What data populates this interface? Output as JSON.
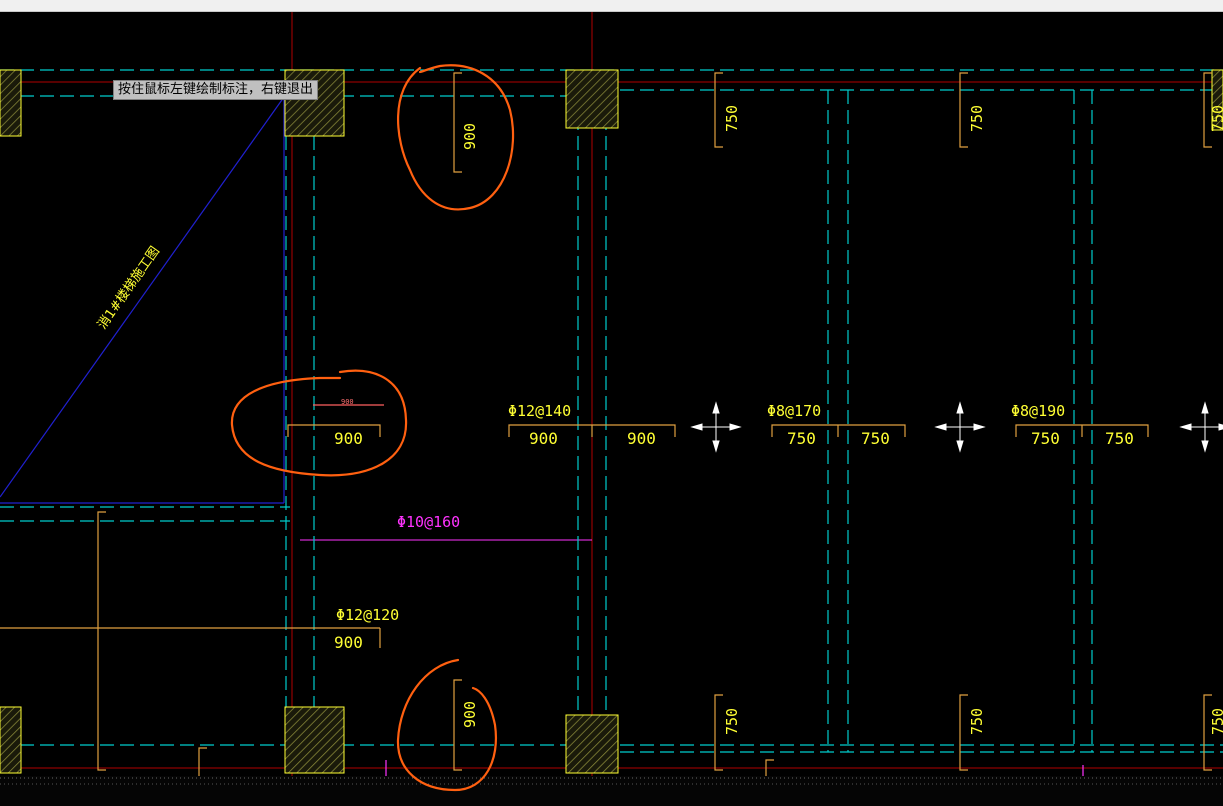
{
  "status": {
    "tooltip": "按住鼠标左键绘制标注，右键退出"
  },
  "colors": {
    "background": "#000000",
    "axis_line": "#b00000",
    "beam_dash": "#00ffff",
    "dimension": "#ffff33",
    "dimension_bracket": "#e0a040",
    "rebar_text": "#ff33ff",
    "column_hatch": "#8a8a3a",
    "diagonal": "#2020d0",
    "markup": "#ff6010"
  },
  "drawing": {
    "dims": {
      "top_900": "900",
      "mid_900": "900",
      "mid_900_small": "900",
      "bot_900": "900",
      "left_900": "900",
      "bottom_left_900": "900",
      "top_750_a": "750",
      "top_750_b": "750",
      "top_750_c": "750",
      "bot_750_a": "750",
      "bot_750_b": "750",
      "bot_750_c": "750",
      "bottom_750": "750",
      "span1_left": "900",
      "span1_right": "900",
      "span2_left": "750",
      "span2_right": "750",
      "span3_left": "750",
      "span3_right": "750"
    },
    "rebar": {
      "label_a": "Φ12@140",
      "label_b": "Φ8@170",
      "label_c": "Φ8@190",
      "label_d": "Φ10@160",
      "label_e": "Φ12@120"
    },
    "diagonal_label": "消1#楼梯施工图"
  }
}
